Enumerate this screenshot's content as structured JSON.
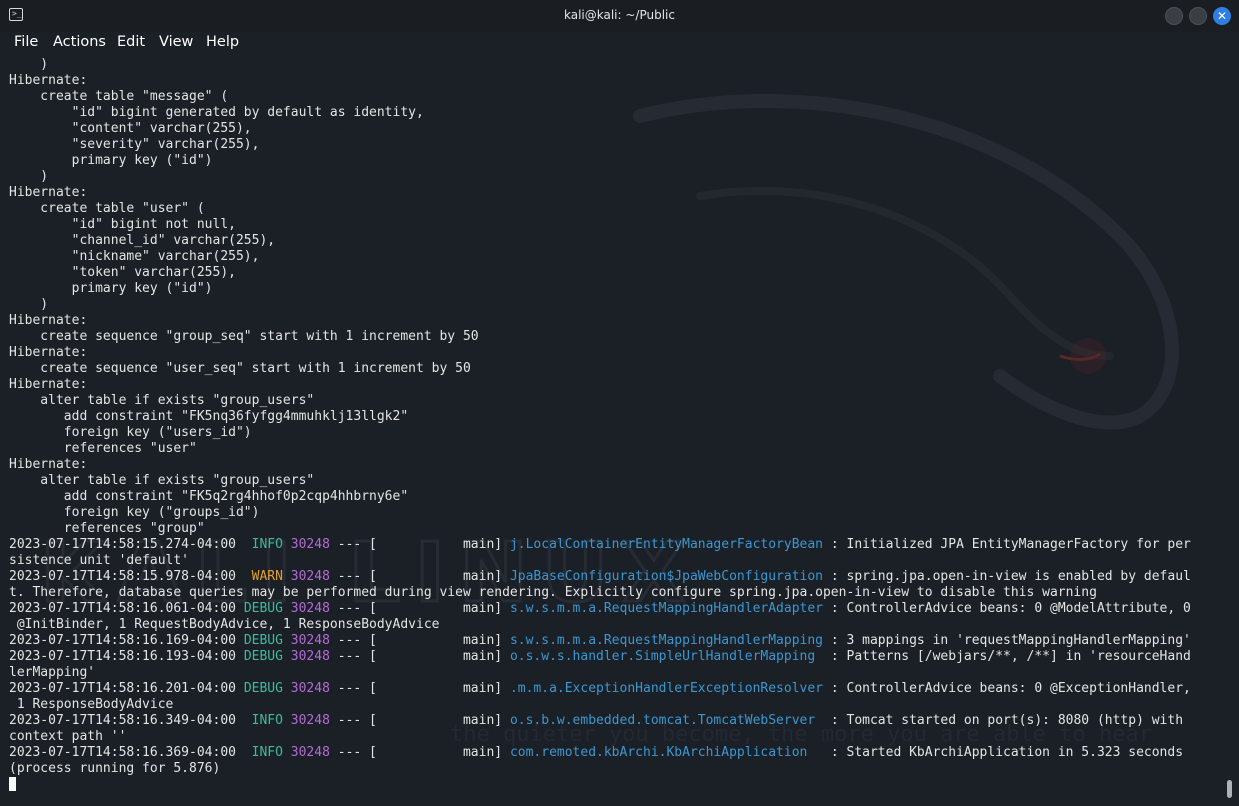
{
  "window": {
    "title": "kali@kali: ~/Public",
    "close_glyph": "✕",
    "app_icon_glyph": ">_"
  },
  "menu": [
    "File",
    "Actions",
    "Edit",
    "View",
    "Help"
  ],
  "watermark": {
    "logo_text": "KALI LINUX",
    "tagline": "the quieter you become, the more you are able to hear"
  },
  "terminal": {
    "lines": [
      [
        {
          "t": "    )"
        }
      ],
      [
        {
          "t": "Hibernate:"
        }
      ],
      [
        {
          "t": "    create table \"message\" ("
        }
      ],
      [
        {
          "t": "        \"id\" bigint generated by default as identity,"
        }
      ],
      [
        {
          "t": "        \"content\" varchar(255),"
        }
      ],
      [
        {
          "t": "        \"severity\" varchar(255),"
        }
      ],
      [
        {
          "t": "        primary key (\"id\")"
        }
      ],
      [
        {
          "t": "    )"
        }
      ],
      [
        {
          "t": "Hibernate:"
        }
      ],
      [
        {
          "t": "    create table \"user\" ("
        }
      ],
      [
        {
          "t": "        \"id\" bigint not null,"
        }
      ],
      [
        {
          "t": "        \"channel_id\" varchar(255),"
        }
      ],
      [
        {
          "t": "        \"nickname\" varchar(255),"
        }
      ],
      [
        {
          "t": "        \"token\" varchar(255),"
        }
      ],
      [
        {
          "t": "        primary key (\"id\")"
        }
      ],
      [
        {
          "t": "    )"
        }
      ],
      [
        {
          "t": "Hibernate:"
        }
      ],
      [
        {
          "t": "    create sequence \"group_seq\" start with 1 increment by 50"
        }
      ],
      [
        {
          "t": "Hibernate:"
        }
      ],
      [
        {
          "t": "    create sequence \"user_seq\" start with 1 increment by 50"
        }
      ],
      [
        {
          "t": "Hibernate:"
        }
      ],
      [
        {
          "t": "    alter table if exists \"group_users\""
        }
      ],
      [
        {
          "t": "       add constraint \"FK5nq36fyfgg4mmuhklj13llgk2\""
        }
      ],
      [
        {
          "t": "       foreign key (\"users_id\")"
        }
      ],
      [
        {
          "t": "       references \"user\""
        }
      ],
      [
        {
          "t": "Hibernate:"
        }
      ],
      [
        {
          "t": "    alter table if exists \"group_users\""
        }
      ],
      [
        {
          "t": "       add constraint \"FK5q2rg4hhof0p2cqp4hhbrny6e\""
        }
      ],
      [
        {
          "t": "       foreign key (\"groups_id\")"
        }
      ],
      [
        {
          "t": "       references \"group\""
        }
      ],
      [
        {
          "t": "2023-07-17T14:58:15.274-04:00  "
        },
        {
          "t": "INFO",
          "c": "info"
        },
        {
          "t": " "
        },
        {
          "t": "30248",
          "c": "pid"
        },
        {
          "t": " --- [           main] "
        },
        {
          "t": "j.LocalContainerEntityManagerFactoryBean",
          "c": "logger"
        },
        {
          "t": " : Initialized JPA EntityManagerFactory for per"
        }
      ],
      [
        {
          "t": "sistence unit 'default'"
        }
      ],
      [
        {
          "t": "2023-07-17T14:58:15.978-04:00  "
        },
        {
          "t": "WARN",
          "c": "warn"
        },
        {
          "t": " "
        },
        {
          "t": "30248",
          "c": "pid"
        },
        {
          "t": " --- [           main] "
        },
        {
          "t": "JpaBaseConfiguration$JpaWebConfiguration",
          "c": "logger"
        },
        {
          "t": " : spring.jpa.open-in-view is enabled by defaul"
        }
      ],
      [
        {
          "t": "t. Therefore, database queries may be performed during view rendering. Explicitly configure spring.jpa.open-in-view to disable this warning"
        }
      ],
      [
        {
          "t": "2023-07-17T14:58:16.061-04:00 "
        },
        {
          "t": "DEBUG",
          "c": "debug"
        },
        {
          "t": " "
        },
        {
          "t": "30248",
          "c": "pid"
        },
        {
          "t": " --- [           main] "
        },
        {
          "t": "s.w.s.m.m.a.RequestMappingHandlerAdapter",
          "c": "logger"
        },
        {
          "t": " : ControllerAdvice beans: 0 @ModelAttribute, 0"
        }
      ],
      [
        {
          "t": " @InitBinder, 1 RequestBodyAdvice, 1 ResponseBodyAdvice"
        }
      ],
      [
        {
          "t": "2023-07-17T14:58:16.169-04:00 "
        },
        {
          "t": "DEBUG",
          "c": "debug"
        },
        {
          "t": " "
        },
        {
          "t": "30248",
          "c": "pid"
        },
        {
          "t": " --- [           main] "
        },
        {
          "t": "s.w.s.m.m.a.RequestMappingHandlerMapping",
          "c": "logger"
        },
        {
          "t": " : 3 mappings in 'requestMappingHandlerMapping'"
        }
      ],
      [
        {
          "t": "2023-07-17T14:58:16.193-04:00 "
        },
        {
          "t": "DEBUG",
          "c": "debug"
        },
        {
          "t": " "
        },
        {
          "t": "30248",
          "c": "pid"
        },
        {
          "t": " --- [           main] "
        },
        {
          "t": "o.s.w.s.handler.SimpleUrlHandlerMapping",
          "c": "logger"
        },
        {
          "t": "  : Patterns [/webjars/**, /**] in 'resourceHand"
        }
      ],
      [
        {
          "t": "lerMapping'"
        }
      ],
      [
        {
          "t": "2023-07-17T14:58:16.201-04:00 "
        },
        {
          "t": "DEBUG",
          "c": "debug"
        },
        {
          "t": " "
        },
        {
          "t": "30248",
          "c": "pid"
        },
        {
          "t": " --- [           main] "
        },
        {
          "t": ".m.m.a.ExceptionHandlerExceptionResolver",
          "c": "logger"
        },
        {
          "t": " : ControllerAdvice beans: 0 @ExceptionHandler,"
        }
      ],
      [
        {
          "t": " 1 ResponseBodyAdvice"
        }
      ],
      [
        {
          "t": "2023-07-17T14:58:16.349-04:00  "
        },
        {
          "t": "INFO",
          "c": "info"
        },
        {
          "t": " "
        },
        {
          "t": "30248",
          "c": "pid"
        },
        {
          "t": " --- [           main] "
        },
        {
          "t": "o.s.b.w.embedded.tomcat.TomcatWebServer",
          "c": "logger"
        },
        {
          "t": "  : Tomcat started on port(s): 8080 (http) with"
        }
      ],
      [
        {
          "t": "context path ''"
        }
      ],
      [
        {
          "t": "2023-07-17T14:58:16.369-04:00  "
        },
        {
          "t": "INFO",
          "c": "info"
        },
        {
          "t": " "
        },
        {
          "t": "30248",
          "c": "pid"
        },
        {
          "t": " --- [           main] "
        },
        {
          "t": "com.remoted.kbArchi.KbArchiApplication",
          "c": "logger"
        },
        {
          "t": "   : Started KbArchiApplication in 5.323 seconds"
        }
      ],
      [
        {
          "t": "(process running for 5.876)"
        }
      ]
    ]
  }
}
